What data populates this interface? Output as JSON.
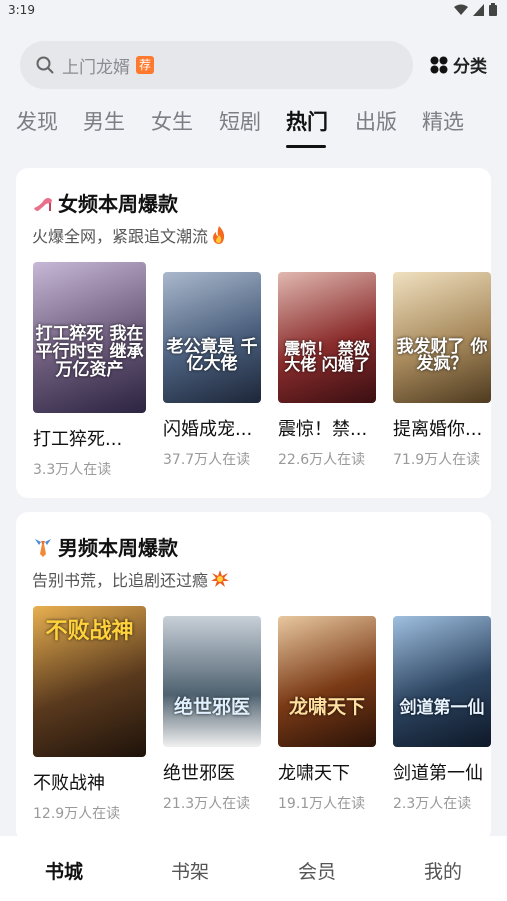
{
  "status": {
    "time": "3:19"
  },
  "search": {
    "placeholder": "上门龙婿",
    "tag": "荐"
  },
  "category_button": {
    "label": "分类"
  },
  "tabs": [
    {
      "label": "发现"
    },
    {
      "label": "男生"
    },
    {
      "label": "女生"
    },
    {
      "label": "短剧"
    },
    {
      "label": "热门",
      "active": true
    },
    {
      "label": "出版"
    },
    {
      "label": "精选"
    }
  ],
  "sections": [
    {
      "icon": "high-heel-icon",
      "title": "女频本周爆款",
      "subtitle": "火爆全网，紧跟追文潮流",
      "subtitle_icon": "fire-icon",
      "books": [
        {
          "title": "打工猝死...",
          "readers": "3.3万人在读",
          "cover_text": "打工猝死 我在平行时空 继承万亿资产",
          "cover_color": "#6b5a7a"
        },
        {
          "title": "闪婚成宠...",
          "readers": "37.7万人在读",
          "cover_text": "老公竟是 千亿大佬",
          "cover_color": "#4a5f7d"
        },
        {
          "title": "震惊！禁...",
          "readers": "22.6万人在读",
          "cover_text": "震惊！ 禁欲大佬 闪婚了",
          "cover_color": "#8a2c2c"
        },
        {
          "title": "提离婚你...",
          "readers": "71.9万人在读",
          "cover_text": "我发财了 你发疯？",
          "cover_color": "#a88a5c"
        }
      ]
    },
    {
      "icon": "necktie-icon",
      "title": "男频本周爆款",
      "subtitle": "告别书荒，比追剧还过瘾",
      "subtitle_icon": "explosion-icon",
      "books": [
        {
          "title": "不败战神",
          "readers": "12.9万人在读",
          "cover_text": "不败战神",
          "cover_color": "#5a3a1e"
        },
        {
          "title": "绝世邪医",
          "readers": "21.3万人在读",
          "cover_text": "绝世邪医",
          "cover_color": "#4f6270"
        },
        {
          "title": "龙啸天下",
          "readers": "19.1万人在读",
          "cover_text": "龙啸天下",
          "cover_color": "#7a3a16"
        },
        {
          "title": "剑道第一仙",
          "readers": "2.3万人在读",
          "cover_text": "剑道第一仙",
          "cover_color": "#2c4460"
        }
      ]
    }
  ],
  "bottom_nav": [
    {
      "label": "书城",
      "active": true
    },
    {
      "label": "书架"
    },
    {
      "label": "会员"
    },
    {
      "label": "我的"
    }
  ]
}
